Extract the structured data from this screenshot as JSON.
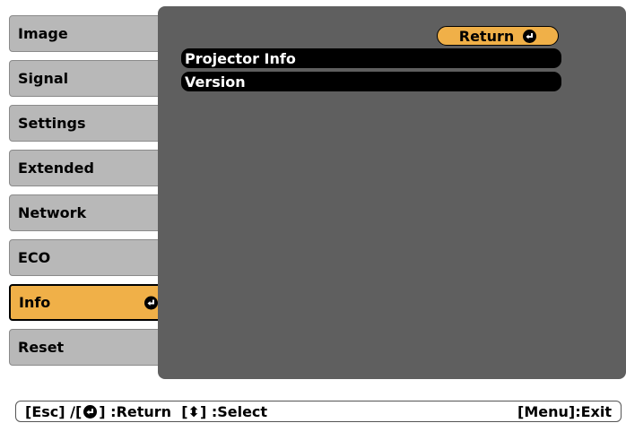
{
  "sidebar": {
    "items": [
      {
        "label": "Image"
      },
      {
        "label": "Signal"
      },
      {
        "label": "Settings"
      },
      {
        "label": "Extended"
      },
      {
        "label": "Network"
      },
      {
        "label": "ECO"
      },
      {
        "label": "Info",
        "active": true
      },
      {
        "label": "Reset"
      }
    ]
  },
  "main": {
    "return_label": "Return",
    "rows": [
      "Projector Info",
      "Version"
    ]
  },
  "footer": {
    "esc_text": "[Esc] /[",
    "return_text": "] :Return  [",
    "select_text": "] :Select",
    "select_icon": "⬍",
    "exit_text": "[Menu]:Exit"
  },
  "colors": {
    "active": "#f0b048",
    "sidebar_bg": "#b8b8b8",
    "panel_bg": "#5f5f5f",
    "row_bg": "#000000"
  },
  "icons": {
    "enter": "enter-icon",
    "updown": "updown-arrow-icon"
  }
}
